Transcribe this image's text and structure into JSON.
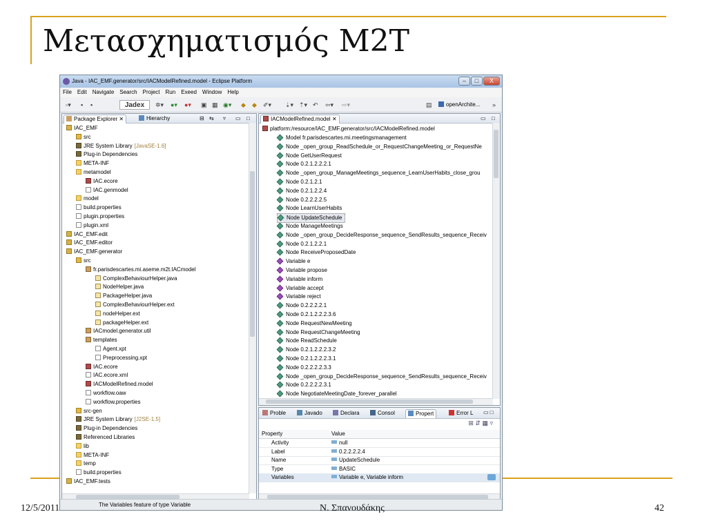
{
  "slide": {
    "title": "Μετασχηματισμός M2T",
    "date": "12/5/2011",
    "author": "Ν. Σπανουδάκης",
    "page_number": "42",
    "accent_color": "#d9a21b"
  },
  "eclipse": {
    "window_title": "Java - IAC_EMF.generator/src/IACModelRefined.model - Eclipse Platform",
    "window_buttons": {
      "minimize": "–",
      "maximize": "□",
      "close": "X"
    },
    "menu": [
      "File",
      "Edit",
      "Navigate",
      "Search",
      "Project",
      "Run",
      "Exeed",
      "Window",
      "Help"
    ],
    "toolbar": {
      "jadex_label": "Jadex",
      "open_arch_label": "openArchite...",
      "overflow": "»"
    },
    "explorer": {
      "tab_package_explorer": "Package Explorer",
      "tab_hierarchy": "Hierarchy",
      "items": [
        {
          "label": "IAC_EMF",
          "icon": "project-icon"
        },
        {
          "label": "src",
          "icon": "source-folder-icon"
        },
        {
          "label": "JRE System Library",
          "suffix": "[JavaSE-1.6]",
          "icon": "library-icon"
        },
        {
          "label": "Plug-in Dependencies",
          "icon": "library-icon"
        },
        {
          "label": "META-INF",
          "icon": "folder-icon"
        },
        {
          "label": "metamodel",
          "icon": "folder-icon"
        },
        {
          "label": "IAC.ecore",
          "icon": "ecore-file-icon"
        },
        {
          "label": "IAC.genmodel",
          "icon": "file-icon"
        },
        {
          "label": "model",
          "icon": "folder-icon"
        },
        {
          "label": "build.properties",
          "icon": "file-icon"
        },
        {
          "label": "plugin.properties",
          "icon": "file-icon"
        },
        {
          "label": "plugin.xml",
          "icon": "file-icon"
        },
        {
          "label": "IAC_EMF.edit",
          "icon": "project-icon"
        },
        {
          "label": "IAC_EMF.editor",
          "icon": "project-icon"
        },
        {
          "label": "IAC_EMF.generator",
          "icon": "project-icon"
        },
        {
          "label": "src",
          "icon": "source-folder-icon"
        },
        {
          "label": "fr.parisdescartes.mi.aseme.m2t.IACmodel",
          "icon": "package-icon"
        },
        {
          "label": "ComplexBehaviourHelper.java",
          "icon": "java-file-icon"
        },
        {
          "label": "NodeHelper.java",
          "icon": "java-file-icon"
        },
        {
          "label": "PackageHelper.java",
          "icon": "java-file-icon"
        },
        {
          "label": "ComplexBehaviourHelper.ext",
          "icon": "ext-file-icon"
        },
        {
          "label": "nodeHelper.ext",
          "icon": "ext-file-icon"
        },
        {
          "label": "packageHelper.ext",
          "icon": "ext-file-icon"
        },
        {
          "label": "IACmodel.generator.util",
          "icon": "package-icon"
        },
        {
          "label": "templates",
          "icon": "package-icon"
        },
        {
          "label": "Agent.xpt",
          "icon": "file-icon"
        },
        {
          "label": "Preprocessing.xpt",
          "icon": "file-icon"
        },
        {
          "label": "IAC.ecore",
          "icon": "ecore-file-icon"
        },
        {
          "label": "IAC.ecore.xml",
          "icon": "file-icon"
        },
        {
          "label": "IACModelRefined.model",
          "icon": "ecore-file-icon"
        },
        {
          "label": "workflow.oaw",
          "icon": "file-icon"
        },
        {
          "label": "workflow.properties",
          "icon": "file-icon"
        },
        {
          "label": "src-gen",
          "icon": "source-folder-icon"
        },
        {
          "label": "JRE System Library",
          "suffix": "[J2SE-1.5]",
          "icon": "library-icon"
        },
        {
          "label": "Plug-in Dependencies",
          "icon": "library-icon"
        },
        {
          "label": "Referenced Libraries",
          "icon": "library-icon"
        },
        {
          "label": "lib",
          "icon": "folder-icon"
        },
        {
          "label": "META-INF",
          "icon": "folder-icon"
        },
        {
          "label": "temp",
          "icon": "folder-icon"
        },
        {
          "label": "build.properties",
          "icon": "file-icon"
        },
        {
          "label": "IAC_EMF.tests",
          "icon": "project-icon"
        }
      ]
    },
    "editor": {
      "tab_label": "IACModelRefined.model",
      "root": "platform:/resource/IAC_EMF.generator/src/IACModelRefined.model",
      "items": [
        {
          "label": "Model fr.parisdescartes.mi.meetingsmanagement",
          "kind": "node"
        },
        {
          "label": "Node _open_group_ReadSchedule_or_RequestChangeMeeting_or_RequestNe",
          "kind": "node"
        },
        {
          "label": "Node GetUserRequest",
          "kind": "node"
        },
        {
          "label": "Node 0.2.1.2.2.2.1",
          "kind": "node"
        },
        {
          "label": "Node _open_group_ManageMeetings_sequence_LearnUserHabits_close_grou",
          "kind": "node"
        },
        {
          "label": "Node 0.2.1.2.1",
          "kind": "node"
        },
        {
          "label": "Node 0.2.1.2.2.4",
          "kind": "node"
        },
        {
          "label": "Node 0.2.2.2.2.5",
          "kind": "node"
        },
        {
          "label": "Node LearnUserHabits",
          "kind": "node"
        },
        {
          "label": "Node UpdateSchedule",
          "kind": "node",
          "selected": true
        },
        {
          "label": "Node ManageMeetings",
          "kind": "node"
        },
        {
          "label": "Node _open_group_DecideResponse_sequence_SendResults_sequence_Receiv",
          "kind": "node"
        },
        {
          "label": "Node 0.2.1.2.2.1",
          "kind": "node"
        },
        {
          "label": "Node ReceiveProposedDate",
          "kind": "node"
        },
        {
          "label": "Variable e",
          "kind": "variable"
        },
        {
          "label": "Variable propose",
          "kind": "variable"
        },
        {
          "label": "Variable inform",
          "kind": "variable"
        },
        {
          "label": "Variable accept",
          "kind": "variable"
        },
        {
          "label": "Variable reject",
          "kind": "variable"
        },
        {
          "label": "Node 0.2.2.2.2.1",
          "kind": "node"
        },
        {
          "label": "Node 0.2.1.2.2.2.3.6",
          "kind": "node"
        },
        {
          "label": "Node RequestNewMeeting",
          "kind": "node"
        },
        {
          "label": "Node RequestChangeMeeting",
          "kind": "node"
        },
        {
          "label": "Node ReadSchedule",
          "kind": "node"
        },
        {
          "label": "Node 0.2.1.2.2.2.3.2",
          "kind": "node"
        },
        {
          "label": "Node 0.2.1.2.2.2.3.1",
          "kind": "node"
        },
        {
          "label": "Node 0.2.2.2.2.3.3",
          "kind": "node"
        },
        {
          "label": "Node _open_group_DecideResponse_sequence_SendResults_sequence_Receiv",
          "kind": "node"
        },
        {
          "label": "Node 0.2.2.2.2.3.1",
          "kind": "node"
        },
        {
          "label": "Node NegotiateMeetingDate_forever_parallel",
          "kind": "node"
        }
      ]
    },
    "bottom": {
      "tabs": [
        "Proble",
        "Javado",
        "Declara",
        "Consol",
        "Propert",
        "Error L"
      ],
      "property_header": "Property",
      "value_header": "Value",
      "rows": [
        {
          "property": "Activity",
          "value": "null"
        },
        {
          "property": "Label",
          "value": "0.2.2.2.2.4"
        },
        {
          "property": "Name",
          "value": "UpdateSchedule"
        },
        {
          "property": "Type",
          "value": "BASIC"
        },
        {
          "property": "Variables",
          "value": "Variable e, Variable inform",
          "selected": true
        }
      ]
    },
    "status": "The Variables feature of type Variable"
  }
}
